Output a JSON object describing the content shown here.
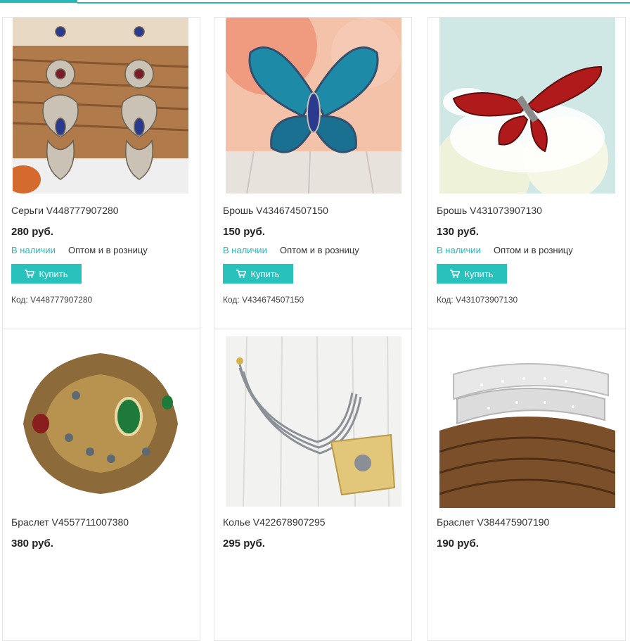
{
  "labels": {
    "in_stock": "В наличии",
    "wholesale": "Оптом и в розницу",
    "buy": "Купить",
    "code_prefix": "Код:"
  },
  "products": [
    {
      "name": "Серьги V448777907280",
      "price": "280 руб.",
      "code": "Код: V448777907280",
      "image": "earrings"
    },
    {
      "name": "Брошь V434674507150",
      "price": "150 руб.",
      "code": "Код: V434674507150",
      "image": "butterfly-brooch"
    },
    {
      "name": "Брошь V431073907130",
      "price": "130 руб.",
      "code": "Код: V431073907130",
      "image": "dragonfly-brooch"
    },
    {
      "name": "Браслет V4557711007380",
      "price": "380 руб.",
      "code": "",
      "image": "bracelet"
    },
    {
      "name": "Колье V422678907295",
      "price": "295 руб.",
      "code": "",
      "image": "necklace"
    },
    {
      "name": "Браслет V384475907190",
      "price": "190 руб.",
      "code": "",
      "image": "wrap-bracelet"
    }
  ],
  "colors": {
    "accent": "#29b8b8",
    "button": "#29c1bb"
  },
  "icons": {
    "buy_icon": "cart-icon"
  }
}
